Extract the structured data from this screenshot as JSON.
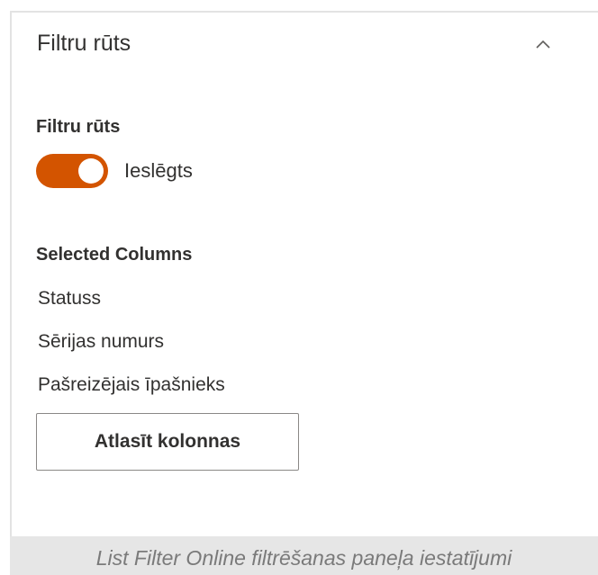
{
  "panel": {
    "title": "Filtru rūts",
    "collapse_icon": "chevron-up-icon"
  },
  "filter_pane": {
    "label": "Filtru rūts",
    "toggle": {
      "state": "on",
      "label": "Ieslēgts",
      "color": "#d35400"
    }
  },
  "selected_columns": {
    "label": "Selected Columns",
    "items": [
      "Statuss",
      "Sērijas numurs",
      "Pašreizējais īpašnieks"
    ]
  },
  "actions": {
    "select_columns_label": "Atlasīt kolonnas"
  },
  "caption": "List Filter Online filtrēšanas paneļa iestatījumi"
}
